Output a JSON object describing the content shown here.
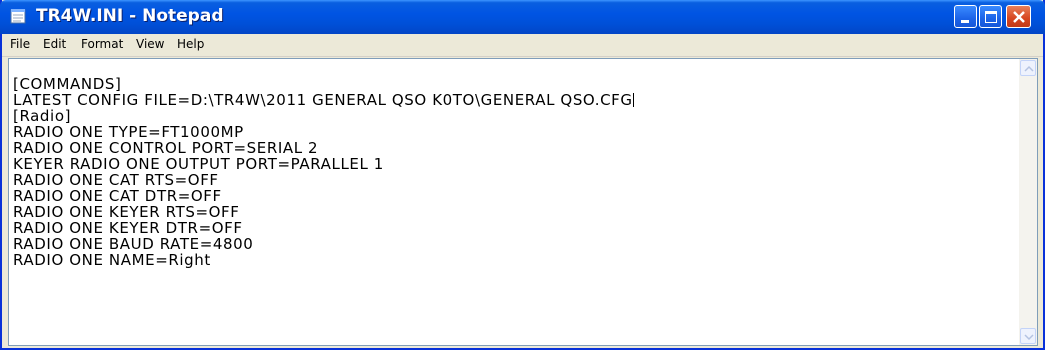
{
  "window": {
    "title": "TR4W.INI - Notepad",
    "title_icon": "notepad-icon",
    "controls": [
      "minimize-icon",
      "maximize-icon",
      "close-icon"
    ]
  },
  "menu": {
    "items": [
      "File",
      "Edit",
      "Format",
      "View",
      "Help"
    ]
  },
  "editor": {
    "lines": [
      "[COMMANDS]",
      "LATEST CONFIG FILE=D:\\TR4W\\2011 GENERAL QSO K0TO\\GENERAL QSO.CFG",
      "[Radio]",
      "RADIO ONE TYPE=FT1000MP",
      "RADIO ONE CONTROL PORT=SERIAL 2",
      "KEYER RADIO ONE OUTPUT PORT=PARALLEL 1",
      "RADIO ONE CAT RTS=OFF",
      "RADIO ONE CAT DTR=OFF",
      "RADIO ONE KEYER RTS=OFF",
      "RADIO ONE KEYER DTR=OFF",
      "RADIO ONE BAUD RATE=4800",
      "RADIO ONE NAME=Right"
    ]
  },
  "colors": {
    "titlebar": "#0054e3",
    "close_button": "#d7451f",
    "menubar": "#ece9d8"
  }
}
